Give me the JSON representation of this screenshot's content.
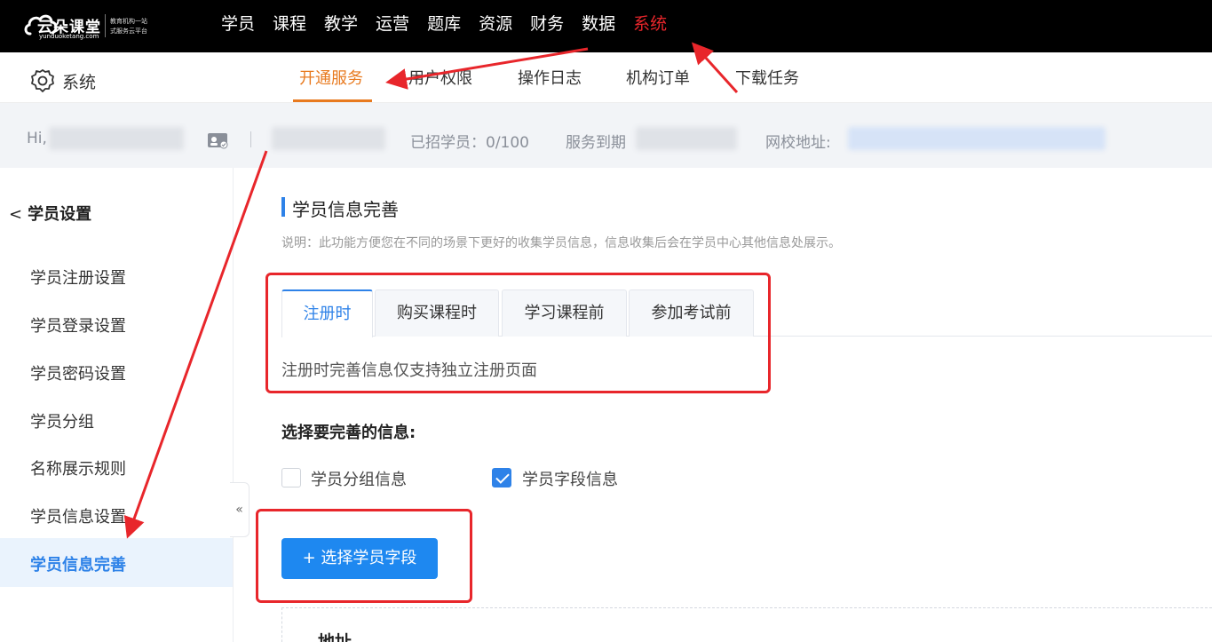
{
  "logo": {
    "title": "云朵课堂",
    "url": "yunduoketang.com",
    "tagline_line1": "教育机构一站",
    "tagline_line2": "式服务云平台"
  },
  "topnav": {
    "items": [
      "学员",
      "课程",
      "教学",
      "运营",
      "题库",
      "资源",
      "财务",
      "数据",
      "系统"
    ],
    "active": "系统"
  },
  "subbar": {
    "section_label": "系统",
    "tabs": [
      "开通服务",
      "用户权限",
      "操作日志",
      "机构订单",
      "下载任务"
    ],
    "active_tab": "开通服务"
  },
  "infobar": {
    "greeting": "Hi,",
    "students_label": "已招学员：0/100",
    "service_label": "服务到期",
    "school_url_label": "网校地址:"
  },
  "sidebar": {
    "back_label": "学员设置",
    "items": [
      "学员注册设置",
      "学员登录设置",
      "学员密码设置",
      "学员分组",
      "名称展示规则",
      "学员信息设置",
      "学员信息完善"
    ],
    "active_item": "学员信息完善",
    "collapse_glyph": "«"
  },
  "main": {
    "title": "学员信息完善",
    "description": "说明：此功能方便您在不同的场景下更好的收集学员信息，信息收集后会在学员中心其他信息处展示。",
    "tabs": [
      "注册时",
      "购买课程时",
      "学习课程前",
      "参加考试前"
    ],
    "active_tab": "注册时",
    "tab_hint": "注册时完善信息仅支持独立注册页面",
    "pick_label": "选择要完善的信息:",
    "options": [
      {
        "label": "学员分组信息",
        "checked": false
      },
      {
        "label": "学员字段信息",
        "checked": true
      }
    ],
    "add_button": "+ 选择学员字段",
    "field_label": "地址"
  },
  "colors": {
    "accent_blue": "#2e82e8",
    "accent_orange": "#e87a1f",
    "annotation_red": "#e8262b"
  }
}
